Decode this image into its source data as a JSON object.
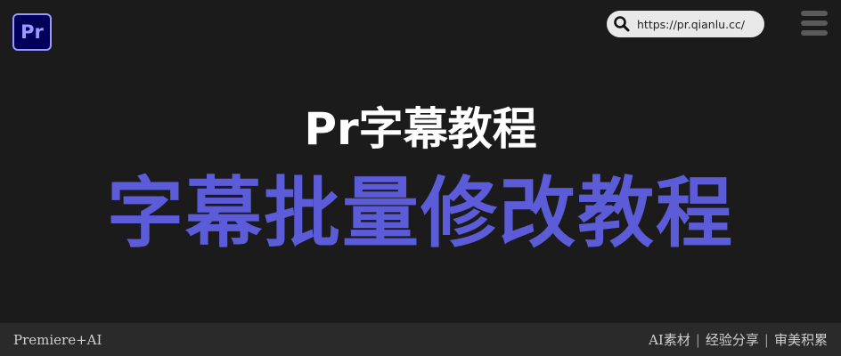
{
  "header": {
    "logo_text": "Pr",
    "url": "https://pr.qianlu.cc/"
  },
  "hero": {
    "subtitle": "Pr字幕教程",
    "title": "字幕批量修改教程"
  },
  "footer": {
    "left": "Premiere+AI",
    "tags": [
      "AI素材",
      "经验分享",
      "审美积累"
    ],
    "separator": "|"
  },
  "colors": {
    "background": "#1b1b1b",
    "title_accent": "#5c5bd8",
    "footer_bg": "#2a2a2a",
    "logo_bg": "#00005b",
    "logo_fg": "#9999ff"
  },
  "icons": {
    "search": "search-icon",
    "menu": "menu-icon"
  }
}
